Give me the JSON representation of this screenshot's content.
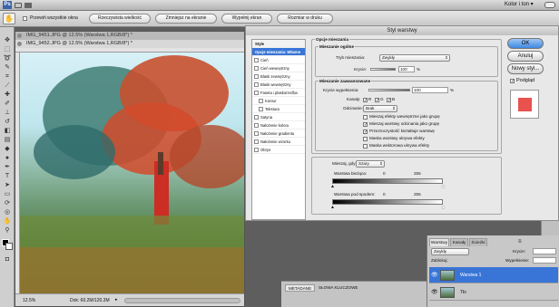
{
  "menubar": {
    "workspace": "Kolor i ton"
  },
  "options_bar": {
    "scroll_all_label": "Przewiń wszystkie okna",
    "actual_pixels": "Rzeczywista wielkość",
    "zoom_to_screen": "Zmniejsz na ekranie",
    "fill_screen": "Wypełnij ekran",
    "print_size": "Rozmiar w druku"
  },
  "documents": {
    "tab_front": "IMG_9451.JPG @ 12.5% (Warstwa 1,RGB/8*) *",
    "tab_back": "IMG_9452.JPG @ 12.5% (Warstwa 1,RGB/8*) *",
    "zoom": "12.5%",
    "doc_info": "Dok: 60.2M/120.3M"
  },
  "dialog": {
    "title": "Styl warstwy",
    "styles_header": "Style",
    "blend_options_item": "Opcje mieszania: Własne",
    "style_items": [
      "Cień",
      "Cień wewnętrzny",
      "Blask zewnętrzny",
      "Blask wewnętrzny",
      "Faseta i płaskorzeźba",
      "Kontur",
      "Tekstura",
      "Satyna",
      "Nałożenie koloru",
      "Nałożenie gradientu",
      "Nałożenie wzorku",
      "Obrys"
    ],
    "blend_section": "Opcje mieszania",
    "general_group": "Mieszanie ogólne",
    "blend_mode_label": "Tryb mieszania:",
    "blend_mode_value": "Zwykły",
    "opacity_label": "Krycie:",
    "opacity_value": "100",
    "percent": "%",
    "advanced_group": "Mieszanie zaawansowane",
    "fill_opacity_label": "Krycie wypełnienia:",
    "fill_opacity_value": "100",
    "channels_label": "Kanały:",
    "channel_r": "R",
    "channel_g": "G",
    "channel_b": "B",
    "knockout_label": "Odcinanie:",
    "knockout_value": "Brak",
    "adv_options": [
      {
        "label": "Mieszaj efekty wewnętrzne jako grupę",
        "checked": false
      },
      {
        "label": "Mieszaj warstwy odcinania jako grupę",
        "checked": true
      },
      {
        "label": "Przezroczystość kształtuje warstwę",
        "checked": true
      },
      {
        "label": "Maska warstwy ukrywa efekty",
        "checked": false
      },
      {
        "label": "Maska wektorowa ukrywa efekty",
        "checked": false
      }
    ],
    "blend_if_label": "Mieszaj, gdy:",
    "blend_if_value": "Szary",
    "this_layer_label": "Warstwa bieżąca:",
    "this_layer_min": "0",
    "this_layer_max": "255",
    "underlying_label": "Warstwa pod spodem:",
    "underlying_min": "0",
    "underlying_max": "255",
    "ok": "OK",
    "cancel": "Anuluj",
    "new_style": "Nowy styl...",
    "preview": "Podgląd",
    "preview_swatch_color": "#e8524f"
  },
  "layers_panel": {
    "tabs": [
      "Warstwy",
      "Kanały",
      "Ścieżki"
    ],
    "blend_mode": "Zwykły",
    "opacity_label": "Krycie:",
    "lock_label": "Zablokuj:",
    "fill_label": "Wypełnienie:",
    "layers": [
      {
        "name": "Warstwa 1",
        "selected": true
      },
      {
        "name": "Tło",
        "selected": false
      }
    ]
  },
  "bottom_panel": {
    "tabs": [
      "METADANE",
      "SŁOWA KLUCZOWE"
    ]
  }
}
